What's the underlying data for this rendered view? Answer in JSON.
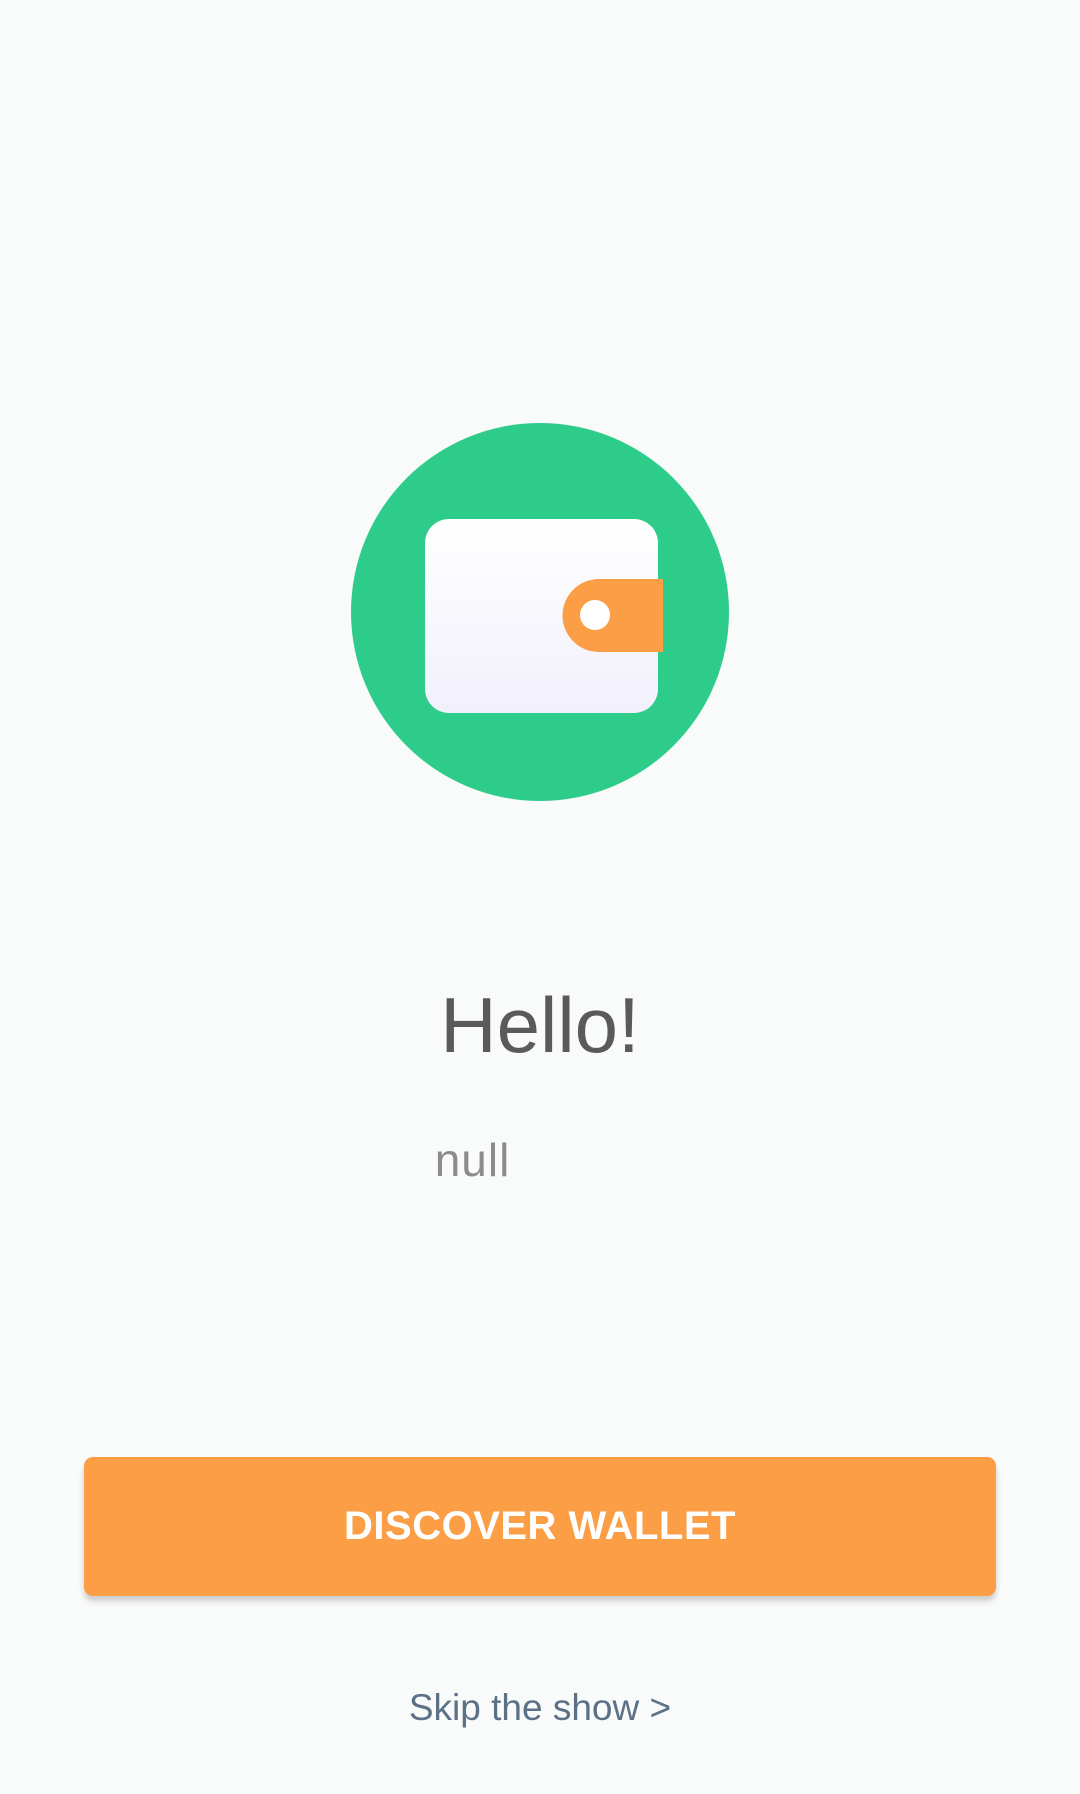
{
  "onboarding": {
    "logo_icon": "wallet-icon",
    "title": "Hello!",
    "subtitle": "null",
    "primary_button_label": "DISCOVER WALLET",
    "skip_label": "Skip the show >"
  },
  "colors": {
    "background": "#f9fafa",
    "logo_circle": "#2ecc8a",
    "wallet_body": "#f6f5fb",
    "wallet_clasp": "#fb9e45",
    "primary_button": "#fb9e45",
    "title_text": "#5a5a5a",
    "skip_text": "#5c7086"
  }
}
